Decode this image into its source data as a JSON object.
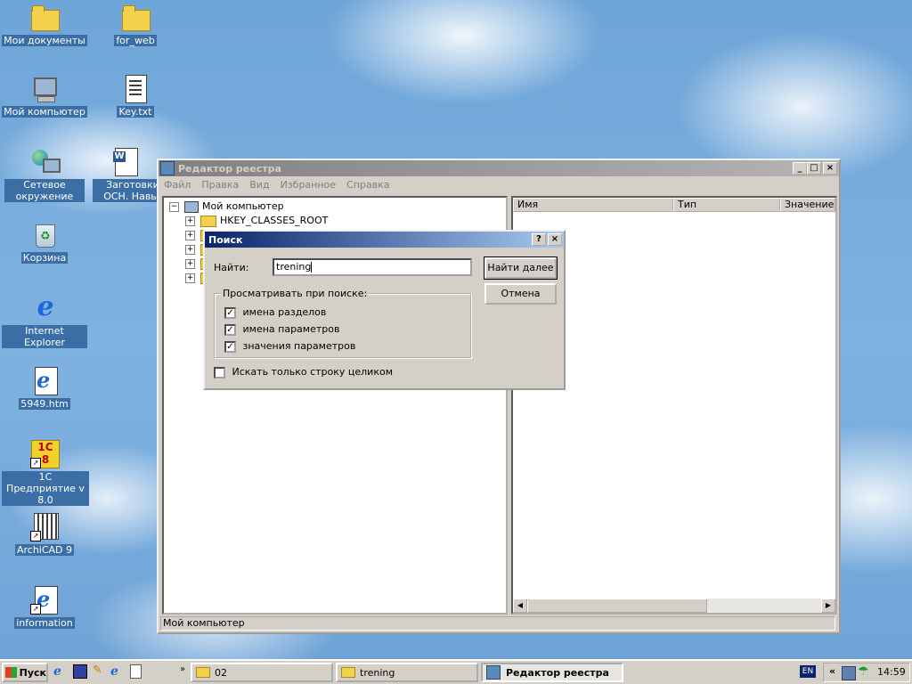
{
  "desktop": {
    "icons": [
      {
        "label": "Мои документы"
      },
      {
        "label": "for_web"
      },
      {
        "label": "Мой компьютер"
      },
      {
        "label": "Key.txt"
      },
      {
        "label": "Сетевое окружение"
      },
      {
        "label": "Заготовки к ОСН. Навыки"
      },
      {
        "label": "Корзина"
      },
      {
        "label": "Internet Explorer"
      },
      {
        "label": "5949.htm"
      },
      {
        "label": "1С Предприятие v 8.0"
      },
      {
        "label": "ArchiCAD 9"
      },
      {
        "label": "information"
      }
    ]
  },
  "regedit": {
    "title": "Редактор реестра",
    "menu": [
      "Файл",
      "Правка",
      "Вид",
      "Избранное",
      "Справка"
    ],
    "tree": {
      "root": "Мой компьютер",
      "first_key": "HKEY_CLASSES_ROOT"
    },
    "columns": [
      "Имя",
      "Тип",
      "Значение"
    ],
    "status": "Мой компьютер",
    "window_buttons": {
      "minimize": "_",
      "maximize": "□",
      "close": "×"
    }
  },
  "find_dialog": {
    "title": "Поиск",
    "help_btn": "?",
    "close_btn": "×",
    "find_label": "Найти:",
    "find_value": "trening",
    "find_next": "Найти далее",
    "cancel": "Отмена",
    "group_label": "Просматривать при поиске:",
    "options": [
      {
        "label": "имена разделов",
        "checked": true
      },
      {
        "label": "имена параметров",
        "checked": true
      },
      {
        "label": "значения параметров",
        "checked": true
      }
    ],
    "whole_string": {
      "label": "Искать только строку целиком",
      "checked": false
    }
  },
  "taskbar": {
    "start": "Пуск",
    "items": [
      "02",
      "trening",
      "Редактор реестра"
    ],
    "lang": "EN",
    "tray_arrows": "«",
    "time": "14:59"
  }
}
